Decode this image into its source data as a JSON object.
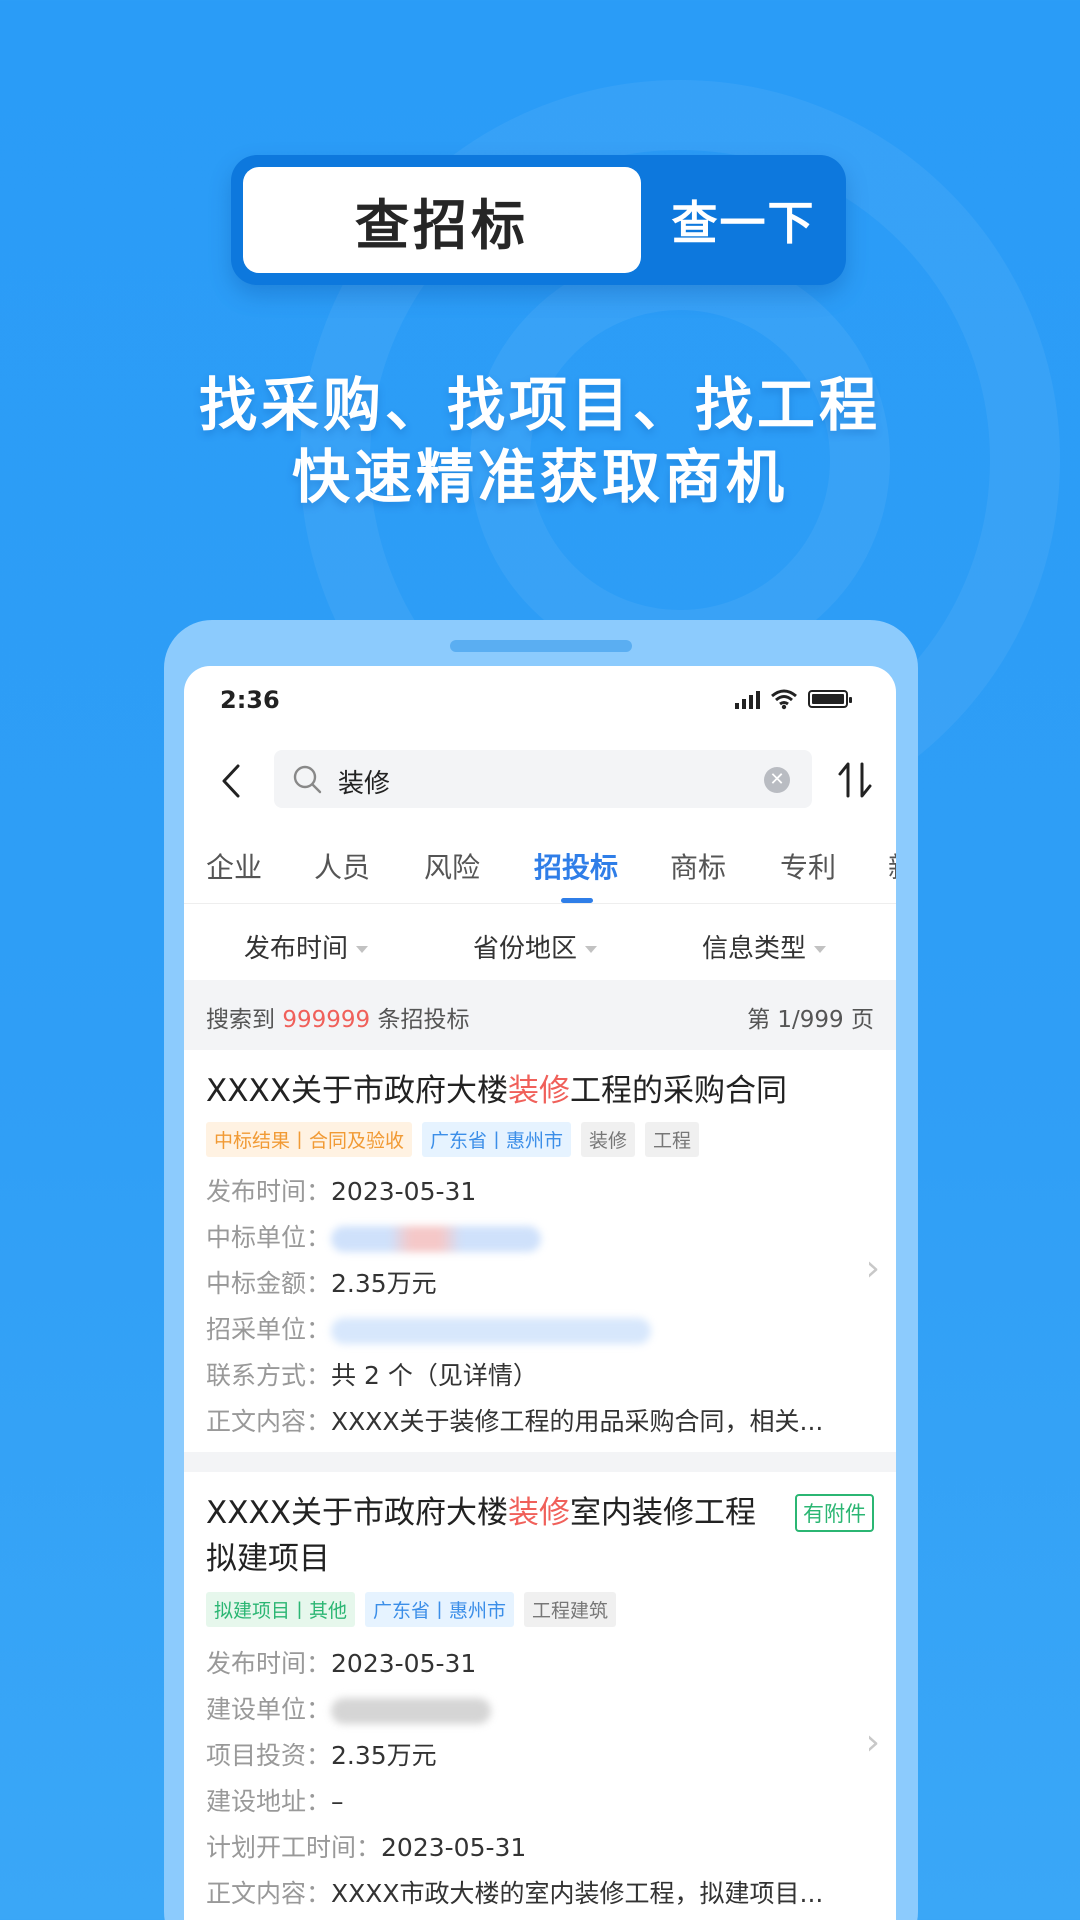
{
  "banner": {
    "query_label": "查招标",
    "button_label": "查一下"
  },
  "headline": {
    "line1": "找采购、找项目、找工程",
    "line2": "快速精准获取商机"
  },
  "status_bar": {
    "time": "2:36"
  },
  "search": {
    "value": "装修"
  },
  "tabs": [
    "企业",
    "人员",
    "风险",
    "招投标",
    "商标",
    "专利",
    "新"
  ],
  "active_tab": "招投标",
  "filters": [
    "发布时间",
    "省份地区",
    "信息类型"
  ],
  "summary": {
    "prefix": "搜索到",
    "count": "999999",
    "suffix": "条招投标",
    "page": "第 1/999 页"
  },
  "results": [
    {
      "title_pre": "XXXX关于市政府大楼",
      "title_hl": "装修",
      "title_post": "工程的采购合同",
      "tags": [
        {
          "text": "中标结果丨合同及验收",
          "color": "orange"
        },
        {
          "text": "广东省丨惠州市",
          "color": "blue"
        },
        {
          "text": "装修",
          "color": "gray"
        },
        {
          "text": "工程",
          "color": "gray"
        }
      ],
      "fields": [
        {
          "label": "发布时间：",
          "value": "2023-05-31"
        },
        {
          "label": "中标单位：",
          "value": ""
        },
        {
          "label": "中标金额：",
          "value": "2.35万元"
        },
        {
          "label": "招采单位：",
          "value": ""
        },
        {
          "label": "联系方式：",
          "value": "共 2 个（见详情）"
        },
        {
          "label": "正文内容：",
          "value": "XXXX关于装修工程的用品采购合同，相关..."
        }
      ]
    },
    {
      "title_pre": "XXXX关于市政府大楼",
      "title_hl": "装修",
      "title_post": "室内装修工程",
      "title_line2": "拟建项目",
      "badge": "有附件",
      "tags": [
        {
          "text": "拟建项目丨其他",
          "color": "green"
        },
        {
          "text": "广东省丨惠州市",
          "color": "blue"
        },
        {
          "text": "工程建筑",
          "color": "gray"
        }
      ],
      "fields": [
        {
          "label": "发布时间：",
          "value": "2023-05-31"
        },
        {
          "label": "建设单位：",
          "value": ""
        },
        {
          "label": "项目投资：",
          "value": "2.35万元"
        },
        {
          "label": "建设地址：",
          "value": "–"
        },
        {
          "label": "计划开工时间：",
          "value": "2023-05-31"
        },
        {
          "label": "正文内容：",
          "value": "XXXX市政大楼的室内装修工程，拟建项目..."
        }
      ]
    }
  ],
  "colors": {
    "accent": "#2f7ee8",
    "highlight": "#f0605a",
    "background": "#2a9cf7"
  }
}
